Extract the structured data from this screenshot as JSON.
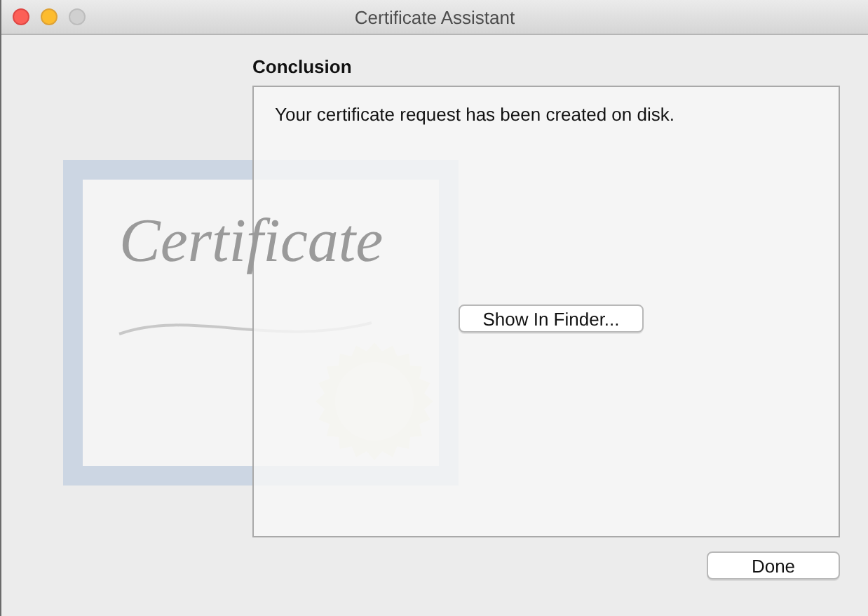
{
  "window": {
    "title": "Certificate Assistant"
  },
  "artwork": {
    "caption": "Certificate"
  },
  "heading": "Conclusion",
  "message": "Your certificate request has been created on disk.",
  "buttons": [
    {
      "kind": "inline",
      "label": "Show In Finder..."
    },
    {
      "kind": "footer",
      "label": "Done"
    }
  ]
}
